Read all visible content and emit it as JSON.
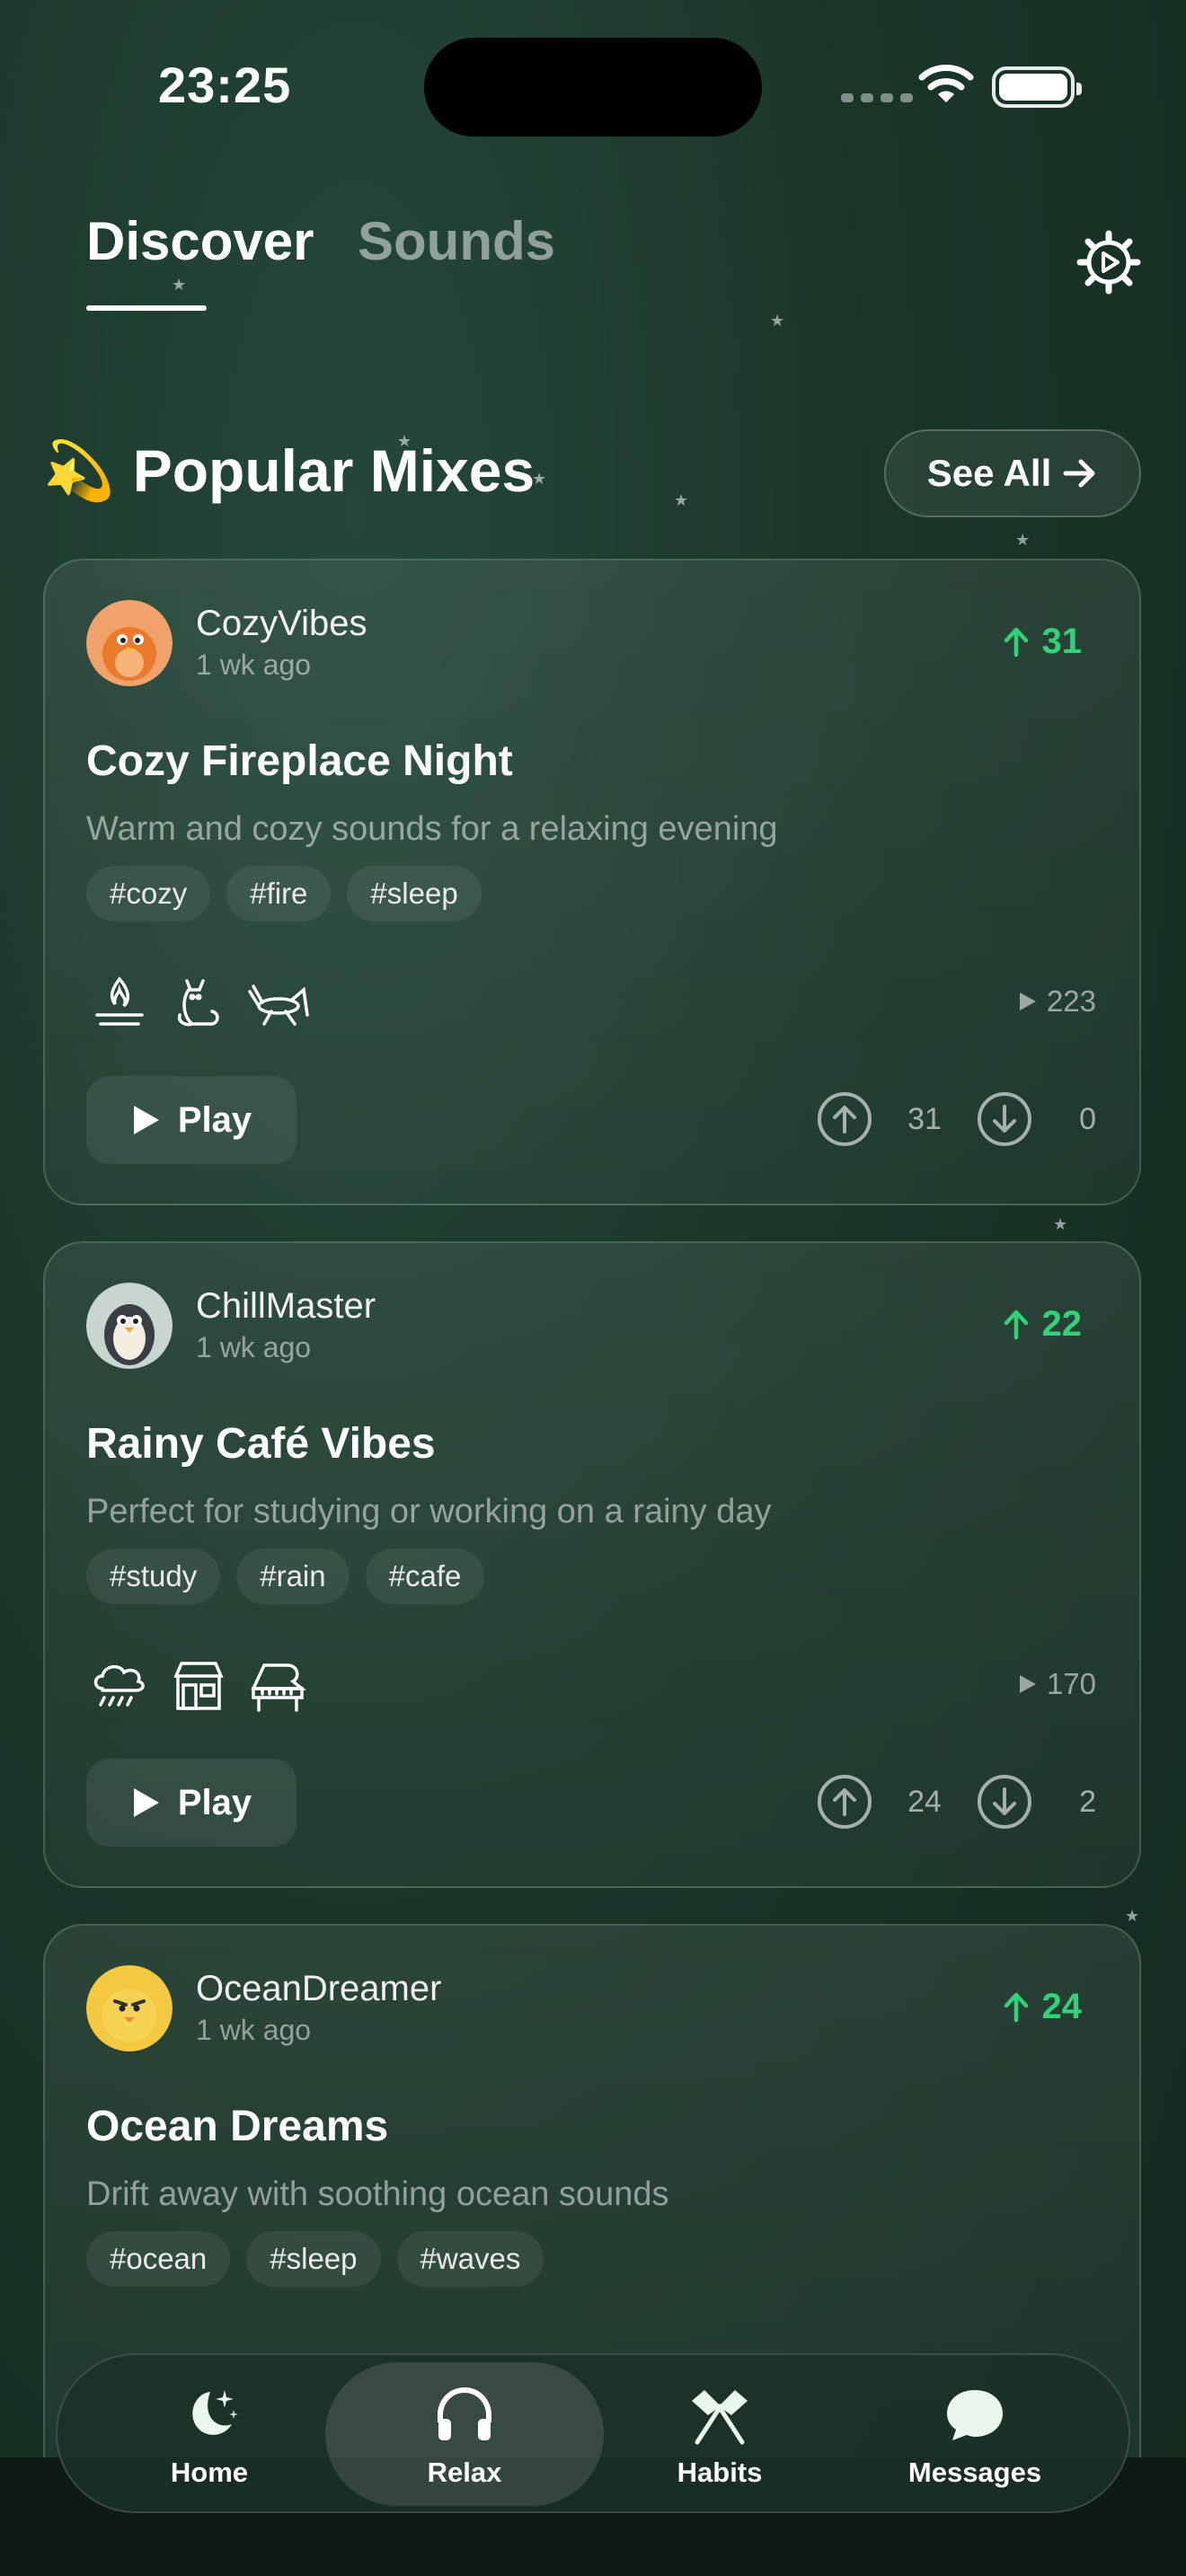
{
  "status_bar": {
    "time": "23:25"
  },
  "tabs": [
    {
      "label": "Discover",
      "active": true
    },
    {
      "label": "Sounds",
      "active": false
    }
  ],
  "section": {
    "emoji": "💫",
    "title": "Popular Mixes",
    "see_all": "See All"
  },
  "mixes": [
    {
      "author": "CozyVibes",
      "ago": "1 wk ago",
      "score": "31",
      "title": "Cozy Fireplace Night",
      "description": "Warm and cozy sounds for a relaxing evening",
      "tags": [
        "#cozy",
        "#fire",
        "#sleep"
      ],
      "sound_icons": [
        "campfire-icon",
        "cat-icon",
        "cricket-icon"
      ],
      "plays": "223",
      "play_label": "Play",
      "upvotes": "31",
      "downvotes": "0"
    },
    {
      "author": "ChillMaster",
      "ago": "1 wk ago",
      "score": "22",
      "title": "Rainy Café Vibes",
      "description": "Perfect for studying or working on a rainy day",
      "tags": [
        "#study",
        "#rain",
        "#cafe"
      ],
      "sound_icons": [
        "rain-cloud-icon",
        "cafe-icon",
        "piano-icon"
      ],
      "plays": "170",
      "play_label": "Play",
      "upvotes": "24",
      "downvotes": "2"
    },
    {
      "author": "OceanDreamer",
      "ago": "1 wk ago",
      "score": "24",
      "title": "Ocean Dreams",
      "description": "Drift away with soothing ocean sounds",
      "tags": [
        "#ocean",
        "#sleep",
        "#waves"
      ]
    }
  ],
  "nav": [
    {
      "label": "Home",
      "icon": "moon-stars-icon",
      "active": false
    },
    {
      "label": "Relax",
      "icon": "headphones-icon",
      "active": true
    },
    {
      "label": "Habits",
      "icon": "crossed-flags-icon",
      "active": false
    },
    {
      "label": "Messages",
      "icon": "chat-bubble-icon",
      "active": false
    }
  ],
  "colors": {
    "accent_green": "#33d17a",
    "background": "#1a3629"
  }
}
